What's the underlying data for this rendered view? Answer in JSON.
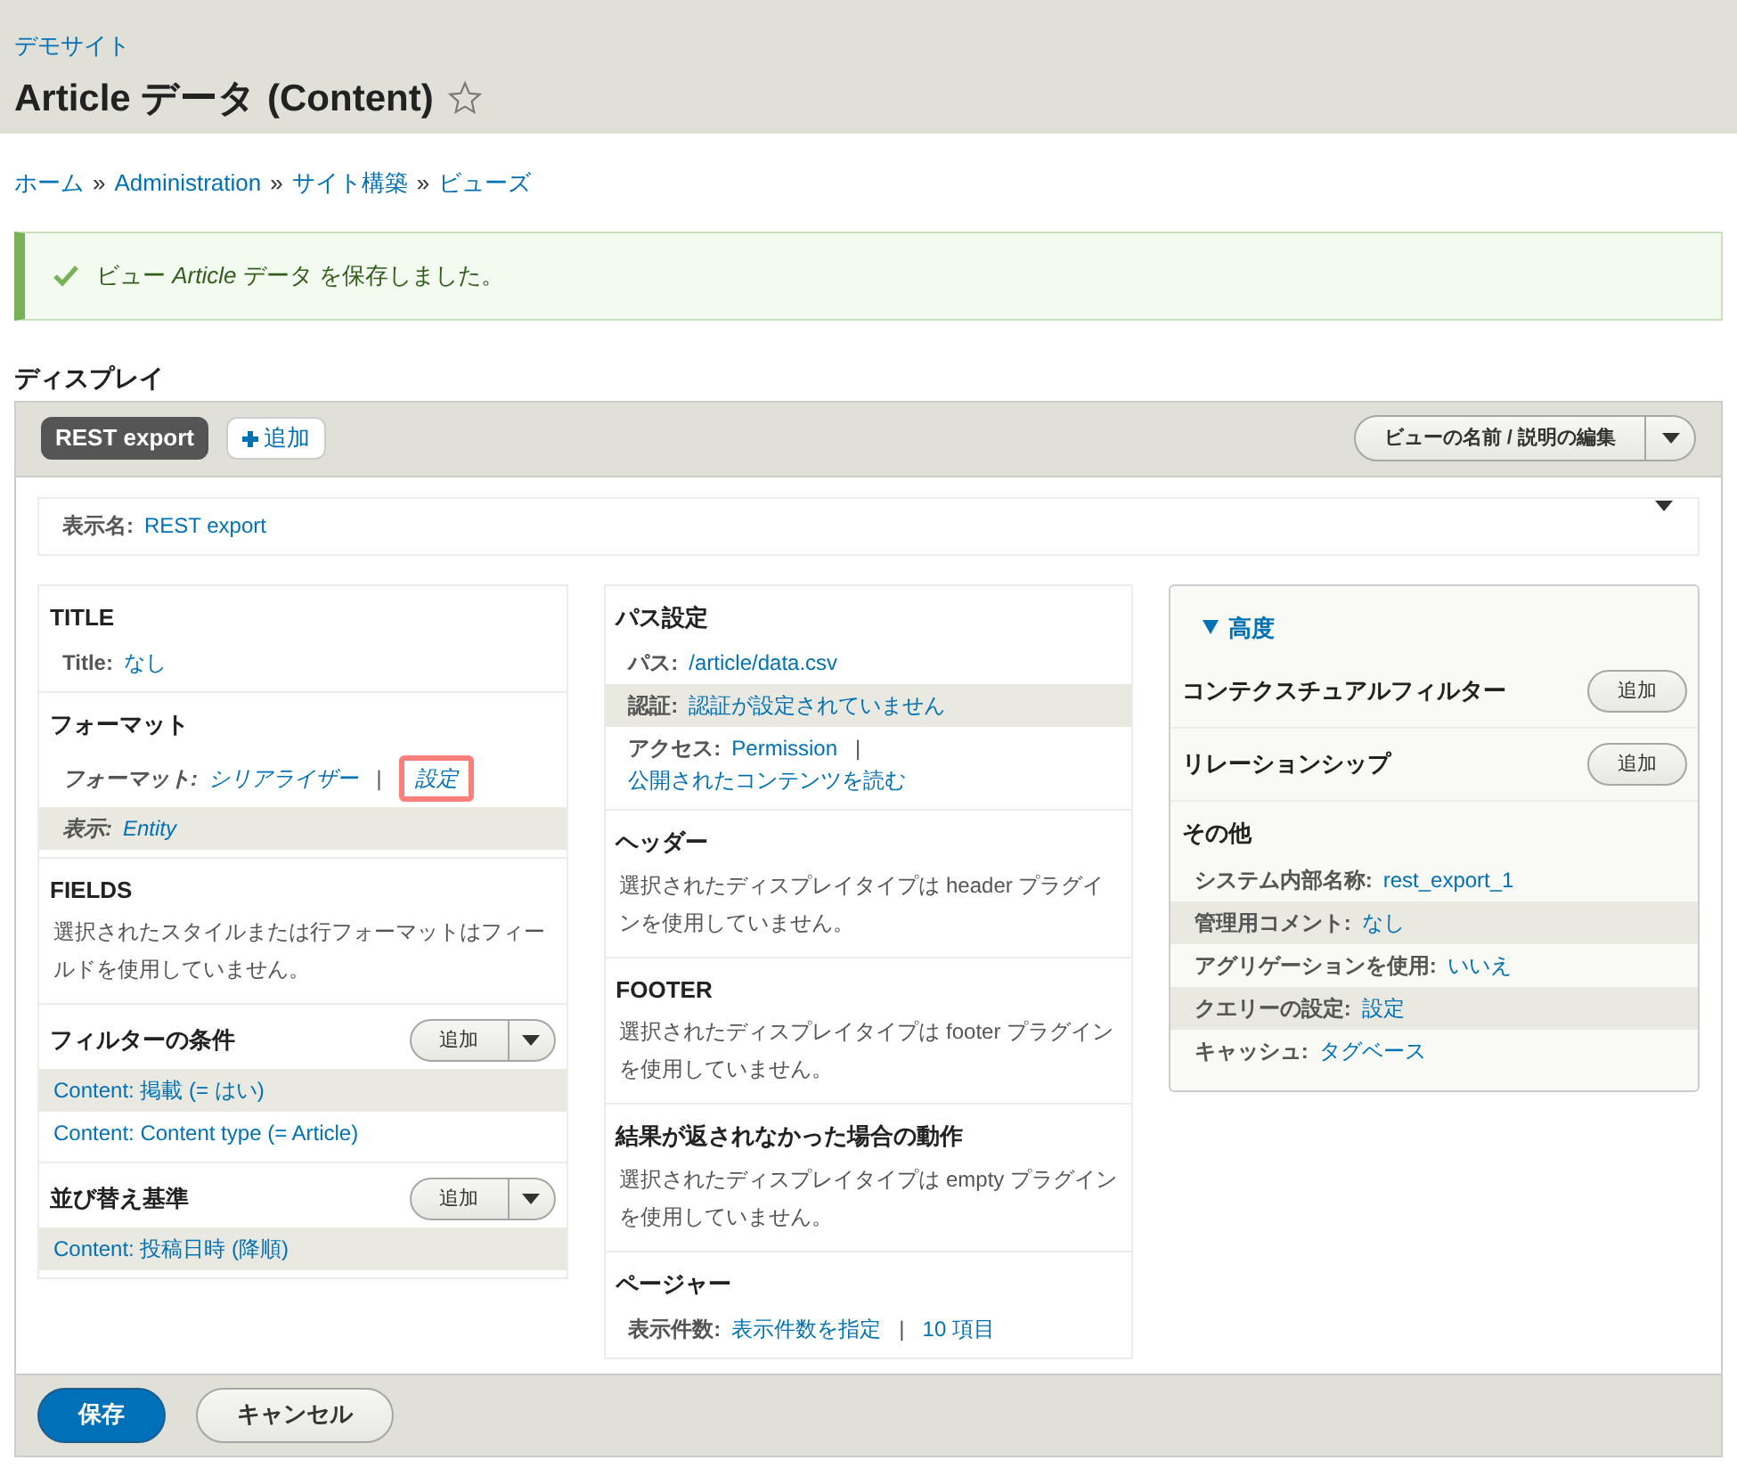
{
  "site_name": "デモサイト",
  "page_title": "Article データ (Content)",
  "breadcrumb": [
    "ホーム",
    "Administration",
    "サイト構築",
    "ビューズ"
  ],
  "breadcrumb_separator": "»",
  "message": "ビュー *Article* データ を保存しました。",
  "display_heading": "ディスプレイ",
  "display_tabs": [
    {
      "label": "REST export",
      "selected": true
    }
  ],
  "add_display_label": "追加",
  "edit_button": "ビューの名前 / 説明の編集",
  "display_name": {
    "label": "表示名:",
    "value": "REST export"
  },
  "columns": [
    {
      "kind": "plain",
      "sections": [
        {
          "title": "TITLE",
          "rows": [
            {
              "kind": "setting",
              "label": "Title:",
              "links": [
                {
                  "text": "なし",
                  "highlighted": false
                }
              ],
              "shaded": false,
              "italic": false
            }
          ]
        },
        {
          "title": "フォーマット",
          "rows": [
            {
              "kind": "setting",
              "label": "フォーマット:",
              "links": [
                {
                  "text": "シリアライザー",
                  "highlighted": false
                },
                {
                  "text": "設定",
                  "highlighted": true
                }
              ],
              "separator": "|",
              "shaded": false,
              "italic": true
            },
            {
              "kind": "setting",
              "label": "表示:",
              "links": [
                {
                  "text": "Entity",
                  "highlighted": false
                }
              ],
              "shaded": true,
              "italic": true
            }
          ]
        },
        {
          "title": "FIELDS",
          "rows": [
            {
              "kind": "text",
              "text": "選択されたスタイルまたは行フォーマットはフィールドを使用していません。"
            }
          ]
        },
        {
          "title": "フィルターの条件",
          "add_button": "追加",
          "dropdown": true,
          "rows": [
            {
              "kind": "link",
              "text": "Content: 掲載 (= はい)",
              "shaded": true
            },
            {
              "kind": "link",
              "text": "Content: Content type (= Article)",
              "shaded": false
            }
          ]
        },
        {
          "title": "並び替え基準",
          "add_button": "追加",
          "dropdown": true,
          "rows": [
            {
              "kind": "link",
              "text": "Content: 投稿日時 (降順)",
              "shaded": true
            }
          ]
        }
      ]
    },
    {
      "kind": "plain",
      "sections": [
        {
          "title": "パス設定",
          "rows": [
            {
              "kind": "setting",
              "label": "パス:",
              "links": [
                {
                  "text": "/article/data.csv",
                  "highlighted": false
                }
              ],
              "shaded": false,
              "italic": false
            },
            {
              "kind": "setting",
              "label": "認証:",
              "links": [
                {
                  "text": "認証が設定されていません",
                  "highlighted": false
                }
              ],
              "shaded": true,
              "italic": false
            },
            {
              "kind": "setting",
              "label": "アクセス:",
              "links": [
                {
                  "text": "Permission",
                  "highlighted": false
                },
                {
                  "text": "公開されたコンテンツを読む",
                  "highlighted": false
                }
              ],
              "separator": "|",
              "shaded": false,
              "italic": false
            }
          ]
        },
        {
          "title": "ヘッダー",
          "rows": [
            {
              "kind": "text",
              "text": "選択されたディスプレイタイプは header プラグインを使用していません。"
            }
          ]
        },
        {
          "title": "FOOTER",
          "rows": [
            {
              "kind": "text",
              "text": "選択されたディスプレイタイプは footer プラグインを使用していません。"
            }
          ]
        },
        {
          "title": "結果が返されなかった場合の動作",
          "rows": [
            {
              "kind": "text",
              "text": "選択されたディスプレイタイプは empty プラグインを使用していません。"
            }
          ]
        },
        {
          "title": "ページャー",
          "rows": [
            {
              "kind": "setting",
              "label": "表示件数:",
              "links": [
                {
                  "text": "表示件数を指定",
                  "highlighted": false
                },
                {
                  "text": "10 項目",
                  "highlighted": false
                }
              ],
              "separator": "|",
              "shaded": false,
              "italic": false
            }
          ]
        }
      ]
    },
    {
      "kind": "details",
      "title": "高度",
      "expanded": true,
      "sections": [
        {
          "title": "コンテクスチュアルフィルター",
          "add_button": "追加",
          "dropdown": false
        },
        {
          "title": "リレーションシップ",
          "add_button": "追加",
          "dropdown": false
        },
        {
          "title": "その他",
          "rows": [
            {
              "kind": "setting",
              "label": "システム内部名称:",
              "links": [
                {
                  "text": "rest_export_1",
                  "highlighted": false
                }
              ],
              "shaded": false,
              "italic": false
            },
            {
              "kind": "setting",
              "label": "管理用コメント:",
              "links": [
                {
                  "text": "なし",
                  "highlighted": false
                }
              ],
              "shaded": true,
              "italic": false
            },
            {
              "kind": "setting",
              "label": "アグリゲーションを使用:",
              "links": [
                {
                  "text": "いいえ",
                  "highlighted": false
                }
              ],
              "shaded": false,
              "italic": false
            },
            {
              "kind": "setting",
              "label": "クエリーの設定:",
              "links": [
                {
                  "text": "設定",
                  "highlighted": false
                }
              ],
              "shaded": true,
              "italic": false
            },
            {
              "kind": "setting",
              "label": "キャッシュ:",
              "links": [
                {
                  "text": "タグベース",
                  "highlighted": false
                }
              ],
              "shaded": false,
              "italic": false
            }
          ]
        }
      ]
    }
  ],
  "footer_buttons": [
    {
      "label": "保存",
      "kind": "primary"
    },
    {
      "label": "キャンセル",
      "kind": "default"
    }
  ]
}
